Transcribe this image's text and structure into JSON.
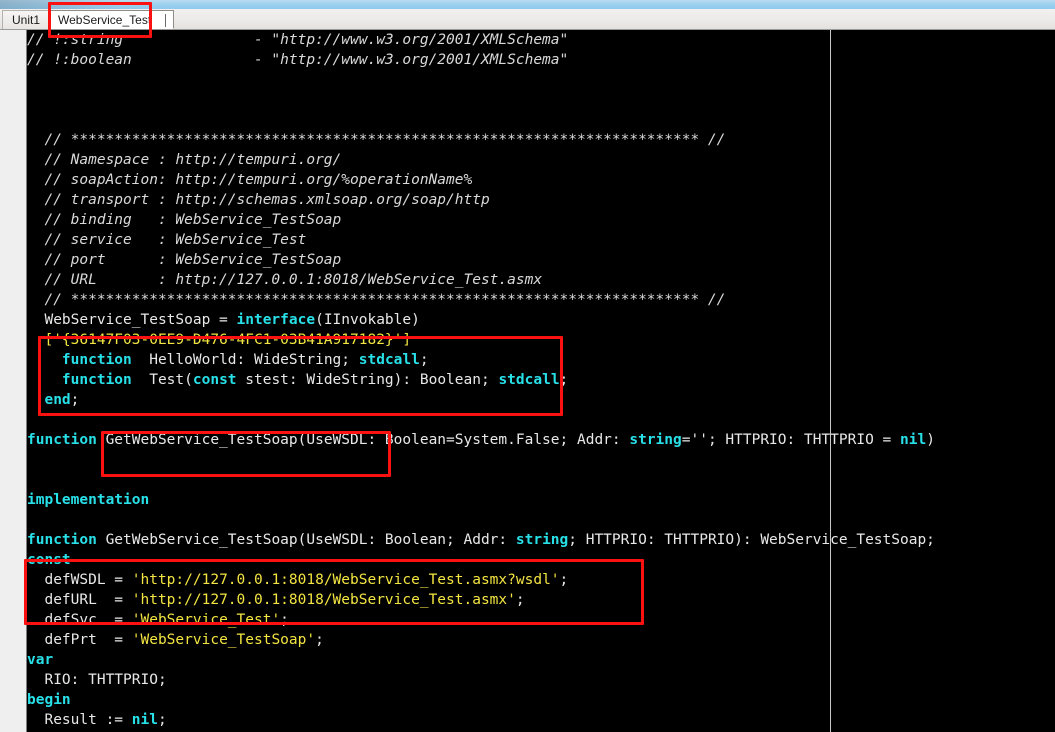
{
  "window": {
    "app": "delphi-code-editor",
    "accent_color": "#9fd1ef"
  },
  "tabs": {
    "items": [
      {
        "label": "Unit1",
        "active": false
      },
      {
        "label": "WebService_Test",
        "active": true
      }
    ]
  },
  "annotations": {
    "color": "#fc1111",
    "boxes": [
      {
        "name": "active-tab-highlight",
        "target": "WebService_Test"
      },
      {
        "name": "interface-block-highlight",
        "target": "WebService_TestSoap interface methods"
      },
      {
        "name": "function-name-highlight",
        "target": "GetWebService_TestSoap"
      },
      {
        "name": "const-urls-highlight",
        "target": "defWSDL / defURL constants"
      }
    ]
  },
  "editor": {
    "language": "Delphi/Object Pascal",
    "lines": [
      [
        {
          "t": "// !:string               - \"http://www.w3.org/2001/XMLSchema\"",
          "c": "cmt"
        }
      ],
      [
        {
          "t": "// !:boolean              - \"http://www.w3.org/2001/XMLSchema\"",
          "c": "cmt"
        }
      ],
      [
        {
          "t": "",
          "c": "plain"
        }
      ],
      [
        {
          "t": "",
          "c": "plain"
        }
      ],
      [
        {
          "t": "",
          "c": "plain"
        }
      ],
      [
        {
          "t": "  // ************************************************************************ //",
          "c": "cmt"
        }
      ],
      [
        {
          "t": "  // Namespace : http://tempuri.org/",
          "c": "cmt"
        }
      ],
      [
        {
          "t": "  // soapAction: http://tempuri.org/%operationName%",
          "c": "cmt"
        }
      ],
      [
        {
          "t": "  // transport : http://schemas.xmlsoap.org/soap/http",
          "c": "cmt"
        }
      ],
      [
        {
          "t": "  // binding   : WebService_TestSoap",
          "c": "cmt"
        }
      ],
      [
        {
          "t": "  // service   : WebService_Test",
          "c": "cmt"
        }
      ],
      [
        {
          "t": "  // port      : WebService_TestSoap",
          "c": "cmt"
        }
      ],
      [
        {
          "t": "  // URL       : http://127.0.0.1:8018/WebService_Test.asmx",
          "c": "cmt"
        }
      ],
      [
        {
          "t": "  // ************************************************************************ //",
          "c": "cmt"
        }
      ],
      [
        {
          "t": "  WebService_TestSoap = ",
          "c": "plain"
        },
        {
          "t": "interface",
          "c": "kw"
        },
        {
          "t": "(IInvokable)",
          "c": "plain"
        }
      ],
      [
        {
          "t": "  ['{36147F03-0EE9-D476-4FC1-03B41A917182}']",
          "c": "guid"
        }
      ],
      [
        {
          "t": "    ",
          "c": "plain"
        },
        {
          "t": "function",
          "c": "kw"
        },
        {
          "t": "  HelloWorld: WideString; ",
          "c": "plain"
        },
        {
          "t": "stdcall",
          "c": "kw"
        },
        {
          "t": ";",
          "c": "plain"
        }
      ],
      [
        {
          "t": "    ",
          "c": "plain"
        },
        {
          "t": "function",
          "c": "kw"
        },
        {
          "t": "  Test(",
          "c": "plain"
        },
        {
          "t": "const",
          "c": "kw"
        },
        {
          "t": " stest: WideString): Boolean; ",
          "c": "plain"
        },
        {
          "t": "stdcall",
          "c": "kw"
        },
        {
          "t": ";",
          "c": "plain"
        }
      ],
      [
        {
          "t": "  ",
          "c": "plain"
        },
        {
          "t": "end",
          "c": "kw"
        },
        {
          "t": ";",
          "c": "plain"
        }
      ],
      [
        {
          "t": "",
          "c": "plain"
        }
      ],
      [
        {
          "t": "function",
          "c": "kw"
        },
        {
          "t": " GetWebService_TestSoap(UseWSDL: Boolean=System.False; Addr: ",
          "c": "plain"
        },
        {
          "t": "string",
          "c": "kw"
        },
        {
          "t": "=''; HTTPRIO: THTTPRIO = ",
          "c": "plain"
        },
        {
          "t": "nil",
          "c": "kw"
        },
        {
          "t": ")",
          "c": "plain"
        }
      ],
      [
        {
          "t": "",
          "c": "plain"
        }
      ],
      [
        {
          "t": "",
          "c": "plain"
        }
      ],
      [
        {
          "t": "implementation",
          "c": "kw"
        }
      ],
      [
        {
          "t": "",
          "c": "plain"
        }
      ],
      [
        {
          "t": "function",
          "c": "kw"
        },
        {
          "t": " GetWebService_TestSoap(UseWSDL: Boolean; Addr: ",
          "c": "plain"
        },
        {
          "t": "string",
          "c": "kw"
        },
        {
          "t": "; HTTPRIO: THTTPRIO): WebService_TestSoap;",
          "c": "plain"
        }
      ],
      [
        {
          "t": "const",
          "c": "kw"
        }
      ],
      [
        {
          "t": "  defWSDL = ",
          "c": "plain"
        },
        {
          "t": "'http://127.0.0.1:8018/WebService_Test.asmx?wsdl'",
          "c": "str"
        },
        {
          "t": ";",
          "c": "plain"
        }
      ],
      [
        {
          "t": "  defURL  = ",
          "c": "plain"
        },
        {
          "t": "'http://127.0.0.1:8018/WebService_Test.asmx'",
          "c": "str"
        },
        {
          "t": ";",
          "c": "plain"
        }
      ],
      [
        {
          "t": "  defSvc  = ",
          "c": "plain"
        },
        {
          "t": "'WebService_Test'",
          "c": "str"
        },
        {
          "t": ";",
          "c": "plain"
        }
      ],
      [
        {
          "t": "  defPrt  = ",
          "c": "plain"
        },
        {
          "t": "'WebService_TestSoap'",
          "c": "str"
        },
        {
          "t": ";",
          "c": "plain"
        }
      ],
      [
        {
          "t": "var",
          "c": "kw"
        }
      ],
      [
        {
          "t": "  RIO: THTTPRIO;",
          "c": "plain"
        }
      ],
      [
        {
          "t": "begin",
          "c": "kw"
        }
      ],
      [
        {
          "t": "  Result := ",
          "c": "plain"
        },
        {
          "t": "nil",
          "c": "kw"
        },
        {
          "t": ";",
          "c": "plain"
        }
      ]
    ]
  }
}
